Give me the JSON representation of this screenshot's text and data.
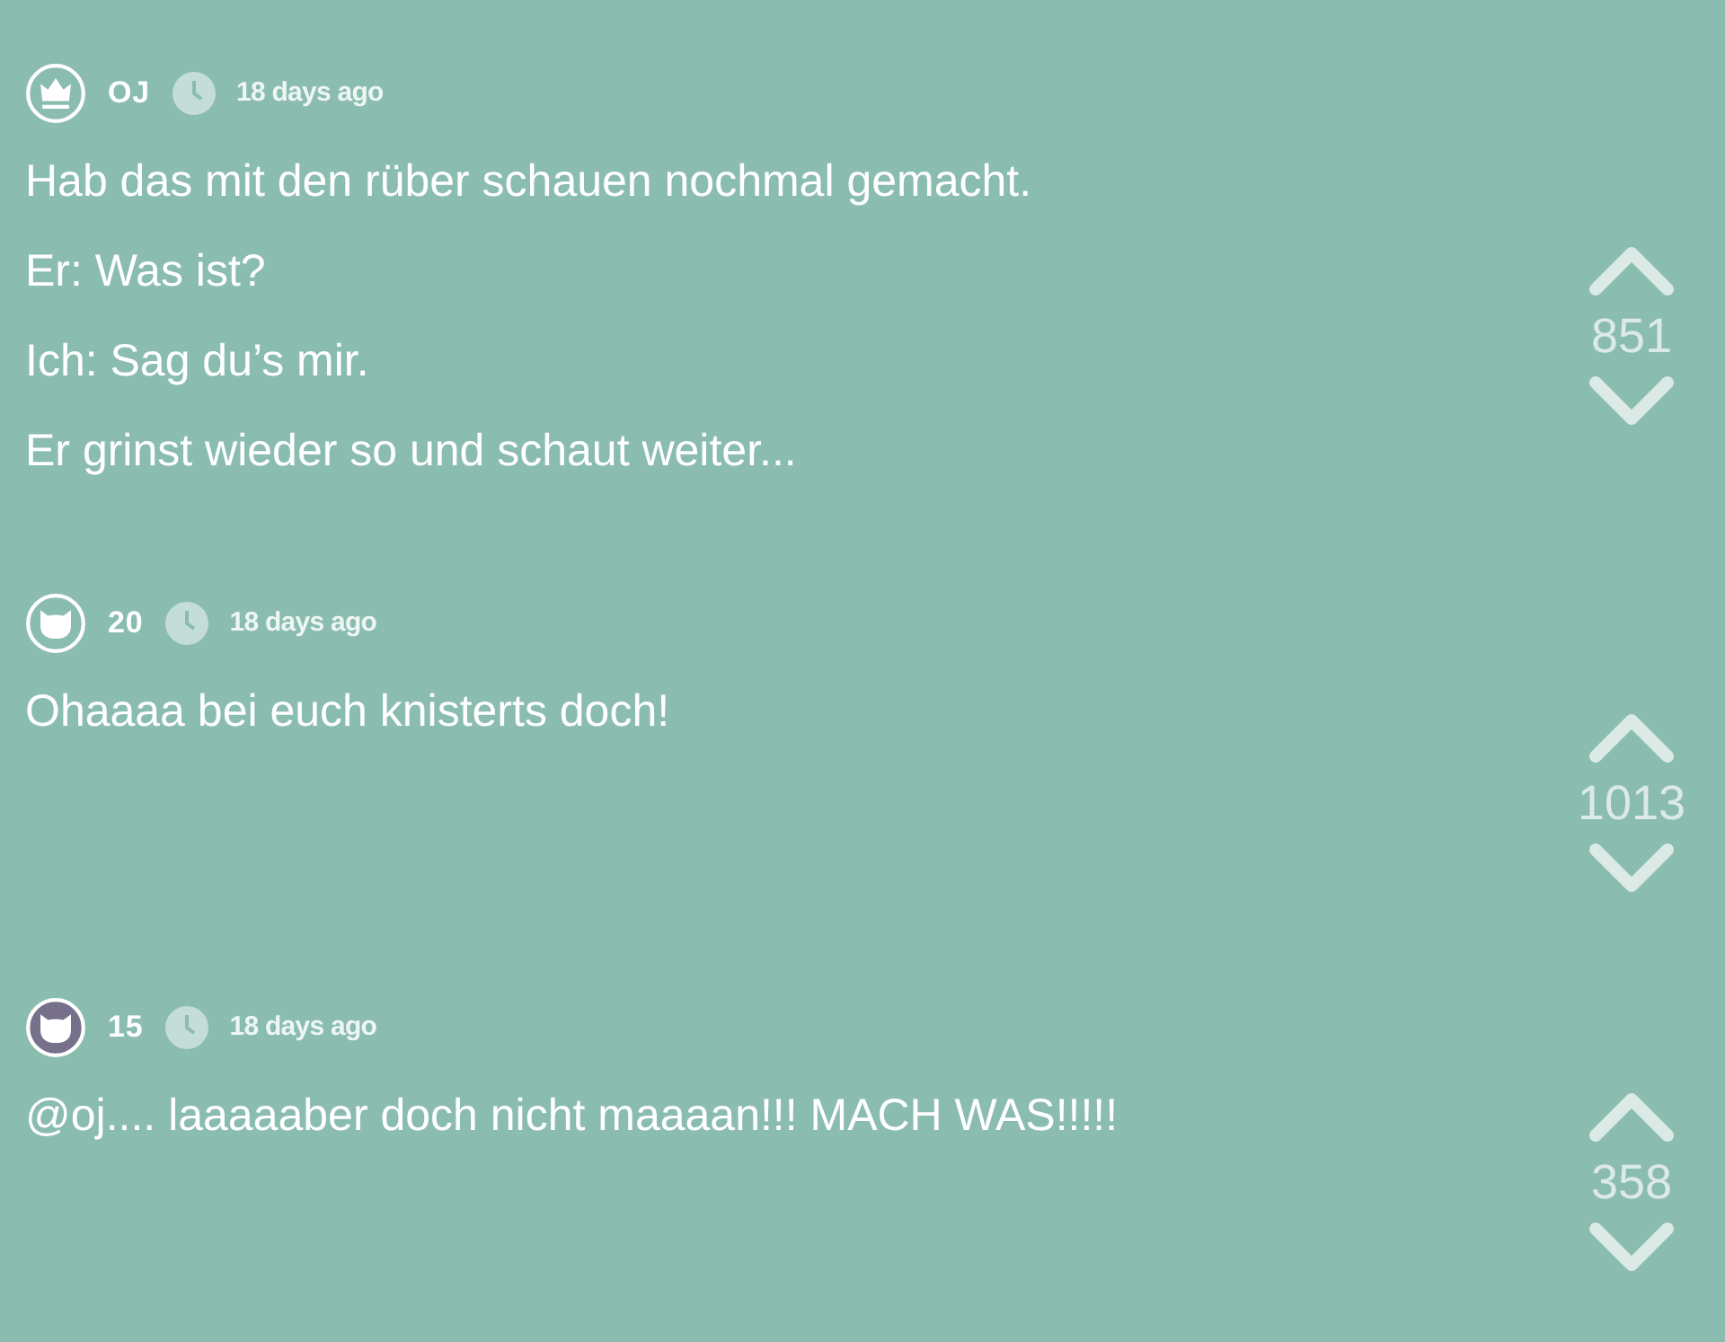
{
  "comments": [
    {
      "author": "OJ",
      "avatar": {
        "kind": "crown"
      },
      "time": "18 days ago",
      "lines": [
        "Hab das mit den rüber schauen nochmal gemacht.",
        "Er: Was ist?",
        "Ich: Sag du’s mir.",
        "Er grinst wieder so und schaut weiter..."
      ],
      "votes": "851"
    },
    {
      "author": "20",
      "avatar": {
        "kind": "cat"
      },
      "time": "18 days ago",
      "lines": [
        "Ohaaaa bei euch knisterts doch!"
      ],
      "votes": "1013"
    },
    {
      "author": "15",
      "avatar": {
        "kind": "cat",
        "color": "#77708a"
      },
      "time": "18 days ago",
      "lines": [
        "@oj.... laaaaaber doch nicht maaaan!!! MACH WAS!!!!!"
      ],
      "votes": "358"
    }
  ]
}
